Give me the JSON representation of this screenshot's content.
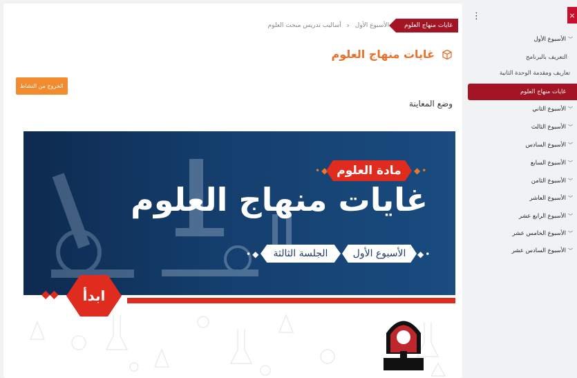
{
  "breadcrumb": {
    "items": [
      "أساليب تدريس مبحث العلوم",
      "الأسبوع الأول"
    ],
    "active": "غايات منهاج العلوم",
    "separator": "‹"
  },
  "page": {
    "title": "غايات منهاج العلوم",
    "exit_button": "الخروج من النشاط",
    "preview_label": "وضع المعاينة"
  },
  "banner": {
    "subject": "مادة العلوم",
    "title": "غايات منهاج العلوم",
    "week_chip": "الأسبوع الأول",
    "session_chip": "الجلسة الثالثة",
    "start_button": "ابدأ",
    "colors": {
      "accent_red": "#e02c1f",
      "navy": "#143e6d",
      "orange": "#e8792f"
    }
  },
  "sidebar": {
    "close_label": "×",
    "menu_label": "⋮",
    "items": [
      {
        "label": "الأسبوع الأول",
        "expanded": true
      },
      {
        "label": "التعريف بالبرنامج",
        "sub": true
      },
      {
        "label": "تعاريف ومقدمة الوحدة الثانية",
        "sub": true
      },
      {
        "label": "غايات منهاج العلوم",
        "sub": true,
        "active": true
      },
      {
        "label": "الأسبوع الثاني"
      },
      {
        "label": "الأسبوع الثالث"
      },
      {
        "label": "الأسبوع السادس"
      },
      {
        "label": "الأسبوع السابع"
      },
      {
        "label": "الأسبوع الثامن"
      },
      {
        "label": "الأسبوع العاشر"
      },
      {
        "label": "الأسبوع الرابع عشر"
      },
      {
        "label": "الأسبوع الخامس عشر"
      },
      {
        "label": "الأسبوع السادس عشر"
      }
    ]
  }
}
